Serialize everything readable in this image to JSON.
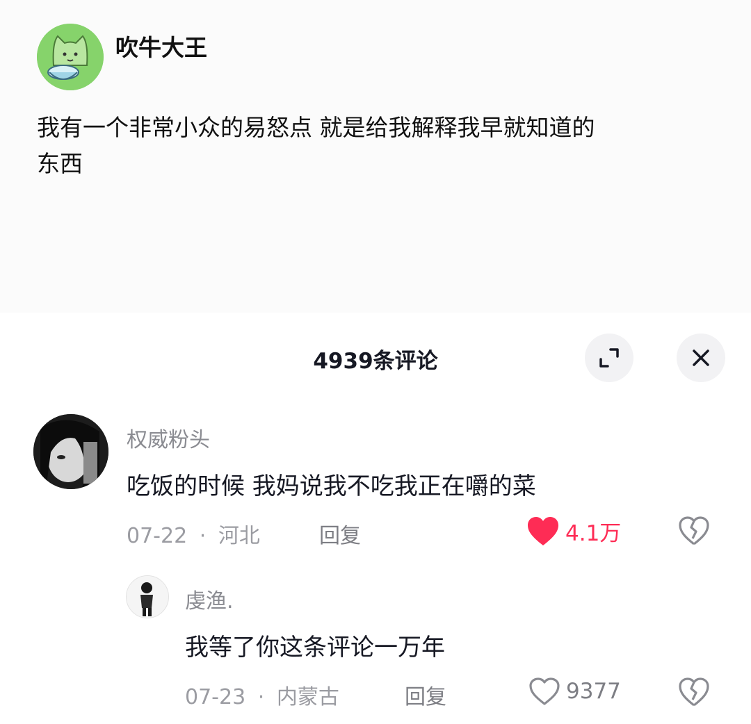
{
  "post": {
    "author": "吹牛大王",
    "text_line1": "我有一个非常小众的易怒点 就是给我解释我早就知道的",
    "text_line2": "东西"
  },
  "sheet": {
    "title": "4939条评论"
  },
  "comments": [
    {
      "name": "权威粉头",
      "text": "吃饭的时候 我妈说我不吃我正在嚼的菜",
      "date": "07-22",
      "separator": "·",
      "location": "河北",
      "reply_label": "回复",
      "likes": "4.1万",
      "liked": true
    },
    {
      "name": "虔渔.",
      "text": "我等了你这条评论一万年",
      "date": "07-23",
      "separator": "·",
      "location": "内蒙古",
      "reply_label": "回复",
      "likes": "9377",
      "liked": false
    }
  ],
  "colors": {
    "like_red": "#fe2c55",
    "muted": "#9b9ca2",
    "text": "#161823"
  },
  "icons": [
    "cat-avatar-icon",
    "expand-icon",
    "close-icon",
    "heart-icon",
    "broken-heart-icon"
  ]
}
